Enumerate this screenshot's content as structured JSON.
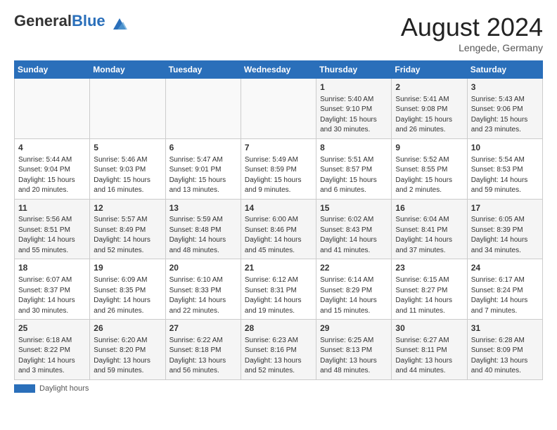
{
  "header": {
    "logo_general": "General",
    "logo_blue": "Blue",
    "month_title": "August 2024",
    "location": "Lengede, Germany"
  },
  "footer": {
    "label": "Daylight hours"
  },
  "weekdays": [
    "Sunday",
    "Monday",
    "Tuesday",
    "Wednesday",
    "Thursday",
    "Friday",
    "Saturday"
  ],
  "weeks": [
    [
      {
        "day": "",
        "info": ""
      },
      {
        "day": "",
        "info": ""
      },
      {
        "day": "",
        "info": ""
      },
      {
        "day": "",
        "info": ""
      },
      {
        "day": "1",
        "info": "Sunrise: 5:40 AM\nSunset: 9:10 PM\nDaylight: 15 hours\nand 30 minutes."
      },
      {
        "day": "2",
        "info": "Sunrise: 5:41 AM\nSunset: 9:08 PM\nDaylight: 15 hours\nand 26 minutes."
      },
      {
        "day": "3",
        "info": "Sunrise: 5:43 AM\nSunset: 9:06 PM\nDaylight: 15 hours\nand 23 minutes."
      }
    ],
    [
      {
        "day": "4",
        "info": "Sunrise: 5:44 AM\nSunset: 9:04 PM\nDaylight: 15 hours\nand 20 minutes."
      },
      {
        "day": "5",
        "info": "Sunrise: 5:46 AM\nSunset: 9:03 PM\nDaylight: 15 hours\nand 16 minutes."
      },
      {
        "day": "6",
        "info": "Sunrise: 5:47 AM\nSunset: 9:01 PM\nDaylight: 15 hours\nand 13 minutes."
      },
      {
        "day": "7",
        "info": "Sunrise: 5:49 AM\nSunset: 8:59 PM\nDaylight: 15 hours\nand 9 minutes."
      },
      {
        "day": "8",
        "info": "Sunrise: 5:51 AM\nSunset: 8:57 PM\nDaylight: 15 hours\nand 6 minutes."
      },
      {
        "day": "9",
        "info": "Sunrise: 5:52 AM\nSunset: 8:55 PM\nDaylight: 15 hours\nand 2 minutes."
      },
      {
        "day": "10",
        "info": "Sunrise: 5:54 AM\nSunset: 8:53 PM\nDaylight: 14 hours\nand 59 minutes."
      }
    ],
    [
      {
        "day": "11",
        "info": "Sunrise: 5:56 AM\nSunset: 8:51 PM\nDaylight: 14 hours\nand 55 minutes."
      },
      {
        "day": "12",
        "info": "Sunrise: 5:57 AM\nSunset: 8:49 PM\nDaylight: 14 hours\nand 52 minutes."
      },
      {
        "day": "13",
        "info": "Sunrise: 5:59 AM\nSunset: 8:48 PM\nDaylight: 14 hours\nand 48 minutes."
      },
      {
        "day": "14",
        "info": "Sunrise: 6:00 AM\nSunset: 8:46 PM\nDaylight: 14 hours\nand 45 minutes."
      },
      {
        "day": "15",
        "info": "Sunrise: 6:02 AM\nSunset: 8:43 PM\nDaylight: 14 hours\nand 41 minutes."
      },
      {
        "day": "16",
        "info": "Sunrise: 6:04 AM\nSunset: 8:41 PM\nDaylight: 14 hours\nand 37 minutes."
      },
      {
        "day": "17",
        "info": "Sunrise: 6:05 AM\nSunset: 8:39 PM\nDaylight: 14 hours\nand 34 minutes."
      }
    ],
    [
      {
        "day": "18",
        "info": "Sunrise: 6:07 AM\nSunset: 8:37 PM\nDaylight: 14 hours\nand 30 minutes."
      },
      {
        "day": "19",
        "info": "Sunrise: 6:09 AM\nSunset: 8:35 PM\nDaylight: 14 hours\nand 26 minutes."
      },
      {
        "day": "20",
        "info": "Sunrise: 6:10 AM\nSunset: 8:33 PM\nDaylight: 14 hours\nand 22 minutes."
      },
      {
        "day": "21",
        "info": "Sunrise: 6:12 AM\nSunset: 8:31 PM\nDaylight: 14 hours\nand 19 minutes."
      },
      {
        "day": "22",
        "info": "Sunrise: 6:14 AM\nSunset: 8:29 PM\nDaylight: 14 hours\nand 15 minutes."
      },
      {
        "day": "23",
        "info": "Sunrise: 6:15 AM\nSunset: 8:27 PM\nDaylight: 14 hours\nand 11 minutes."
      },
      {
        "day": "24",
        "info": "Sunrise: 6:17 AM\nSunset: 8:24 PM\nDaylight: 14 hours\nand 7 minutes."
      }
    ],
    [
      {
        "day": "25",
        "info": "Sunrise: 6:18 AM\nSunset: 8:22 PM\nDaylight: 14 hours\nand 3 minutes."
      },
      {
        "day": "26",
        "info": "Sunrise: 6:20 AM\nSunset: 8:20 PM\nDaylight: 13 hours\nand 59 minutes."
      },
      {
        "day": "27",
        "info": "Sunrise: 6:22 AM\nSunset: 8:18 PM\nDaylight: 13 hours\nand 56 minutes."
      },
      {
        "day": "28",
        "info": "Sunrise: 6:23 AM\nSunset: 8:16 PM\nDaylight: 13 hours\nand 52 minutes."
      },
      {
        "day": "29",
        "info": "Sunrise: 6:25 AM\nSunset: 8:13 PM\nDaylight: 13 hours\nand 48 minutes."
      },
      {
        "day": "30",
        "info": "Sunrise: 6:27 AM\nSunset: 8:11 PM\nDaylight: 13 hours\nand 44 minutes."
      },
      {
        "day": "31",
        "info": "Sunrise: 6:28 AM\nSunset: 8:09 PM\nDaylight: 13 hours\nand 40 minutes."
      }
    ]
  ]
}
